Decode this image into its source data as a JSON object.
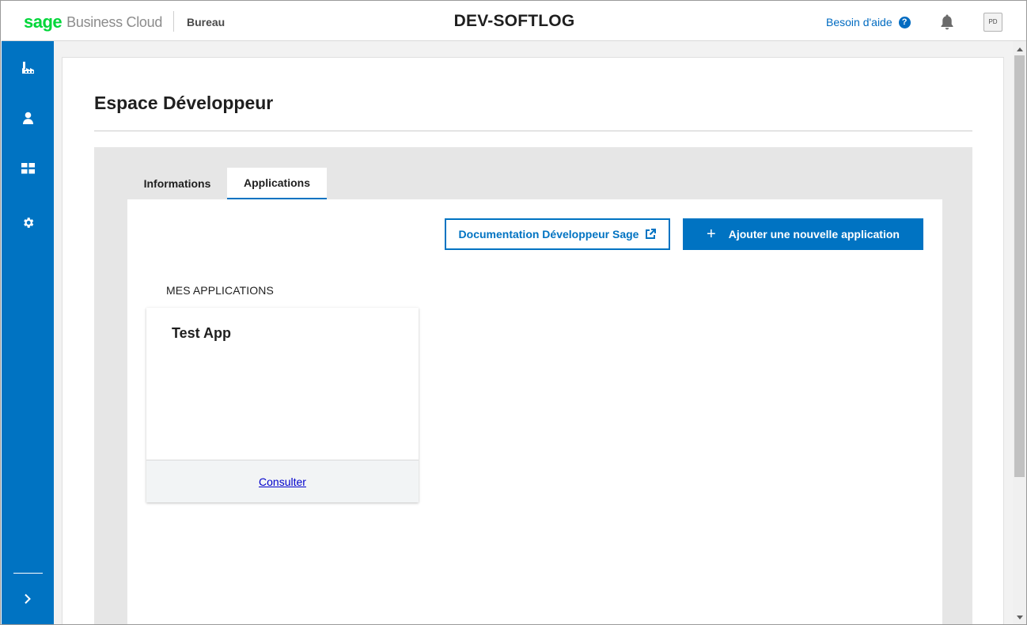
{
  "header": {
    "brand_sage": "sage",
    "brand_product": "Business Cloud",
    "brand_section": "Bureau",
    "company_name": "DEV-SOFTLOG",
    "help_label": "Besoin d'aide",
    "avatar_initials": "PD"
  },
  "sidebar": {
    "items": [
      {
        "icon": "factory-icon"
      },
      {
        "icon": "user-icon"
      },
      {
        "icon": "apps-grid-icon"
      },
      {
        "icon": "gear-icon"
      }
    ],
    "expand_icon": "chevron-right-icon",
    "color": "#0073c2"
  },
  "main": {
    "page_title": "Espace Développeur",
    "tabs": [
      {
        "label": "Informations",
        "active": false
      },
      {
        "label": "Applications",
        "active": true
      }
    ],
    "docs_button": "Documentation Développeur Sage",
    "add_button_plus": "+",
    "add_button": "Ajouter une nouvelle application",
    "section_label": "MES APPLICATIONS",
    "apps": [
      {
        "name": "Test App",
        "action": "Consulter"
      }
    ]
  },
  "colors": {
    "brand_green": "#00d639",
    "accent_blue": "#0073c2",
    "link_blue": "#0000cc"
  }
}
